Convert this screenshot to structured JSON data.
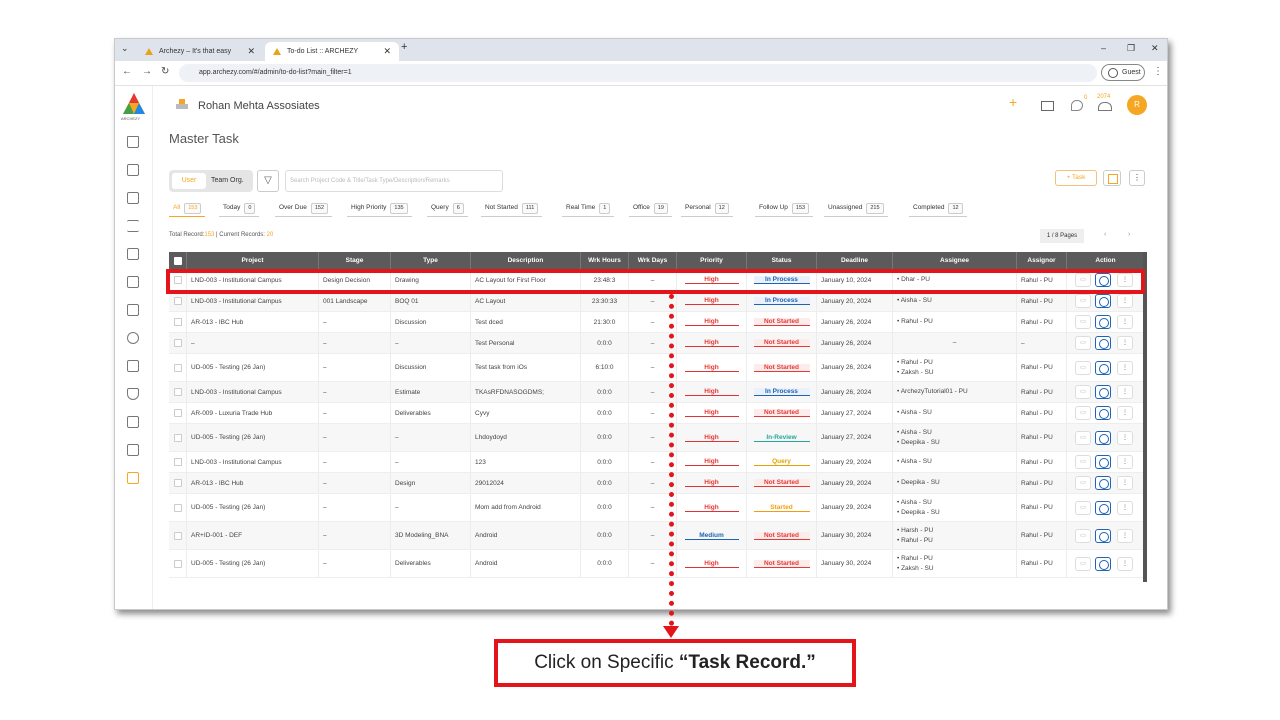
{
  "browser": {
    "tabs": [
      {
        "label": "Archezy – It's that easy",
        "active": false
      },
      {
        "label": "To-do List :: ARCHEZY",
        "active": true
      }
    ],
    "url": "app.archezy.com/#/admin/to-do-list?main_filter=1",
    "guest_label": "Guest",
    "new_tab": "+",
    "minimize": "–",
    "restore": "❐",
    "close": "✕"
  },
  "header": {
    "logo_text": "ARCHEZY",
    "company": "Rohan Mehta Assosiates",
    "chat_count": "0",
    "notif_count": "2074",
    "avatar": "R",
    "accent": "#f5a623"
  },
  "page": {
    "title": "Master Task",
    "toggle": {
      "user": "User",
      "team_org": "Team  Org."
    },
    "search_placeholder": "Search Project Code & Title/Task Type/Description/Remarks",
    "add_task": "+ Task",
    "more": "⋮"
  },
  "chips": [
    {
      "label": "All",
      "count": "153",
      "active": true
    },
    {
      "label": "Today",
      "count": "0"
    },
    {
      "label": "Over Due",
      "count": "152"
    },
    {
      "label": "High Priority",
      "count": "135"
    },
    {
      "label": "Query",
      "count": "6"
    },
    {
      "label": "Not Started",
      "count": "111"
    },
    {
      "label": "Real Time",
      "count": "1"
    },
    {
      "label": "Office",
      "count": "19"
    },
    {
      "label": "Personal",
      "count": "12"
    },
    {
      "label": "Follow Up",
      "count": "153"
    },
    {
      "label": "Unassigned",
      "count": "215"
    },
    {
      "label": "Completed",
      "count": "12"
    }
  ],
  "summary": {
    "total_label": "Total Record:",
    "total": "153",
    "current_label": " | Current Records: ",
    "current": "20",
    "pages": "1 / 8 Pages",
    "prev": "‹",
    "next": "›"
  },
  "table": {
    "columns": [
      "Project",
      "Stage",
      "Type",
      "Description",
      "Wrk Hours",
      "Wrk Days",
      "Priority",
      "Status",
      "Deadline",
      "Assignee",
      "Assignor",
      "Action"
    ],
    "rows": [
      {
        "project": "LND-003 - Institutional Campus",
        "stage": "Design Decision",
        "type": "Drawing",
        "desc": "AC Layout for First Floor",
        "hours": "23:48:3",
        "days": "–",
        "priority": "High",
        "status": "In Process",
        "deadline": "January 10, 2024",
        "assignee": [
          "• Dhar - PU"
        ],
        "assignor": "Rahul - PU"
      },
      {
        "project": "LND-003 - Institutional Campus",
        "stage": "001 Landscape",
        "type": "BOQ 01",
        "desc": "AC Layout",
        "hours": "23:30:33",
        "days": "–",
        "priority": "High",
        "status": "In Process",
        "deadline": "January 20, 2024",
        "assignee": [
          "• Aisha - SU"
        ],
        "assignor": "Rahul - PU"
      },
      {
        "project": "AR-013 - IBC Hub",
        "stage": "–",
        "type": "Discussion",
        "desc": "Test dced",
        "hours": "21:30:0",
        "days": "–",
        "priority": "High",
        "status": "Not Started",
        "deadline": "January 26, 2024",
        "assignee": [
          "• Rahul - PU"
        ],
        "assignor": "Rahul - PU"
      },
      {
        "project": "–",
        "stage": "–",
        "type": "–",
        "desc": "Test Personal",
        "hours": "0:0:0",
        "days": "–",
        "priority": "High",
        "status": "Not Started",
        "deadline": "January 26, 2024",
        "assignee": [
          "–"
        ],
        "assignor": "–"
      },
      {
        "project": "UD-005 - Testing (26 Jan)",
        "stage": "–",
        "type": "Discussion",
        "desc": "Test task from iOs",
        "hours": "6:10:0",
        "days": "–",
        "priority": "High",
        "status": "Not Started",
        "deadline": "January 26, 2024",
        "assignee": [
          "• Rahul - PU",
          "• Zaksh - SU"
        ],
        "assignor": "Rahul - PU"
      },
      {
        "project": "LND-003 - Institutional Campus",
        "stage": "–",
        "type": "Estimate",
        "desc": "TKAsRFDNASOGDMS;",
        "hours": "0:0:0",
        "days": "–",
        "priority": "High",
        "status": "In Process",
        "deadline": "January 26, 2024",
        "assignee": [
          "• ArchezyTutorial01 - PU"
        ],
        "assignor": "Rahul - PU"
      },
      {
        "project": "AR-009 - Luxuria Trade Hub",
        "stage": "–",
        "type": "Deliverables",
        "desc": "Cyvy",
        "hours": "0:0:0",
        "days": "–",
        "priority": "High",
        "status": "Not Started",
        "deadline": "January 27, 2024",
        "assignee": [
          "• Aisha - SU"
        ],
        "assignor": "Rahul - PU"
      },
      {
        "project": "UD-005 - Testing (26 Jan)",
        "stage": "–",
        "type": "–",
        "desc": "Lhdoydoyd",
        "hours": "0:0:0",
        "days": "–",
        "priority": "High",
        "status": "In-Review",
        "deadline": "January 27, 2024",
        "assignee": [
          "• Aisha - SU",
          "• Deepika - SU"
        ],
        "assignor": "Rahul - PU"
      },
      {
        "project": "LND-003 - Institutional Campus",
        "stage": "–",
        "type": "–",
        "desc": "123",
        "hours": "0:0:0",
        "days": "–",
        "priority": "High",
        "status": "Query",
        "deadline": "January 29, 2024",
        "assignee": [
          "• Aisha - SU"
        ],
        "assignor": "Rahul - PU"
      },
      {
        "project": "AR-013 - IBC Hub",
        "stage": "–",
        "type": "Design",
        "desc": "29012024",
        "hours": "0:0:0",
        "days": "–",
        "priority": "High",
        "status": "Not Started",
        "deadline": "January 29, 2024",
        "assignee": [
          "• Deepika - SU"
        ],
        "assignor": "Rahul - PU"
      },
      {
        "project": "UD-005 - Testing (26 Jan)",
        "stage": "–",
        "type": "–",
        "desc": "Mom add from Android",
        "hours": "0:0:0",
        "days": "–",
        "priority": "High",
        "status": "Started",
        "deadline": "January 29, 2024",
        "assignee": [
          "• Aisha - SU",
          "• Deepika - SU"
        ],
        "assignor": "Rahul - PU"
      },
      {
        "project": "AR+ID-001 - DEF",
        "stage": "–",
        "type": "3D Modeling_BNA",
        "desc": "Android",
        "hours": "0:0:0",
        "days": "–",
        "priority": "Medium",
        "status": "Not Started",
        "deadline": "January 30, 2024",
        "assignee": [
          "• Harsh - PU",
          "• Rahul - PU"
        ],
        "assignor": "Rahul - PU"
      },
      {
        "project": "UD-005 - Testing (26 Jan)",
        "stage": "–",
        "type": "Deliverables",
        "desc": "Android",
        "hours": "0:0:0",
        "days": "–",
        "priority": "High",
        "status": "Not Started",
        "deadline": "January 30, 2024",
        "assignee": [
          "• Rahul - PU",
          "• Zaksh - SU"
        ],
        "assignor": "Rahul - PU"
      }
    ]
  },
  "callout": {
    "prefix": "Click on Specific ",
    "bold": "“Task Record.”",
    "color": "#e3141a"
  }
}
